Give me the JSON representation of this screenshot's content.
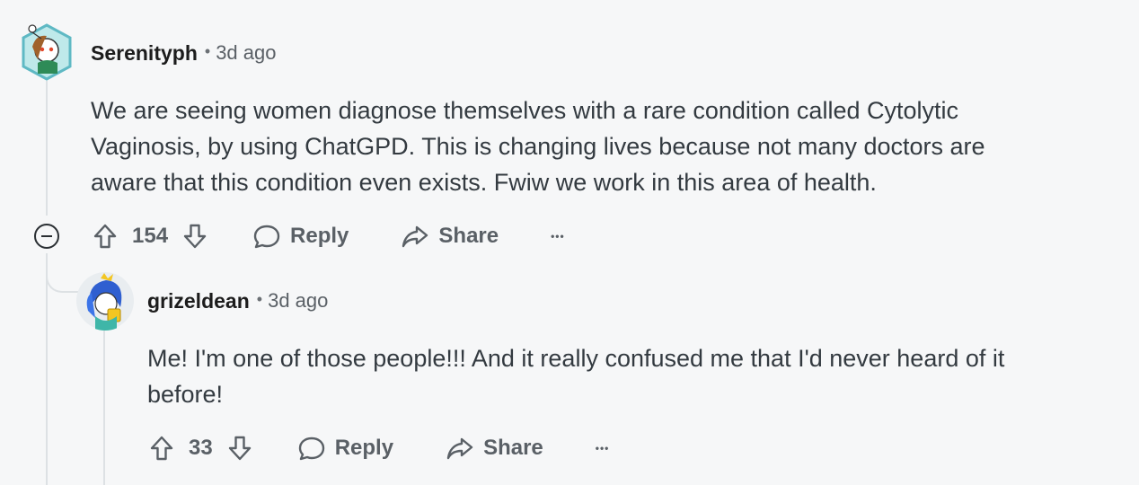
{
  "comments": [
    {
      "username": "Serenityph",
      "separator": "•",
      "time": "3d ago",
      "body_lines": [
        "We are seeing women diagnose themselves with a rare condition called Cytolytic",
        "Vaginosis, by using ChatGPD. This is changing lives because not many doctors are",
        "aware that this condition even exists. Fwiw we work in this area of health."
      ],
      "votes": "154",
      "reply_label": "Reply",
      "share_label": "Share",
      "more_label": "•••"
    },
    {
      "username": "grizeldean",
      "separator": "•",
      "time": "3d ago",
      "body_lines": [
        "Me! I'm one of those people!!! And it really confused me that I'd never heard of it",
        "before!"
      ],
      "votes": "33",
      "reply_label": "Reply",
      "share_label": "Share",
      "more_label": "•••"
    }
  ],
  "icons": {
    "upvote": "arrow-up-icon",
    "downvote": "arrow-down-icon",
    "reply": "speech-bubble-icon",
    "share": "share-arrow-icon",
    "collapse": "minus-circle-icon"
  },
  "colors": {
    "background": "#f6f7f8",
    "text": "#333a40",
    "muted": "#5a6066",
    "thread_line": "#dde1e4"
  }
}
